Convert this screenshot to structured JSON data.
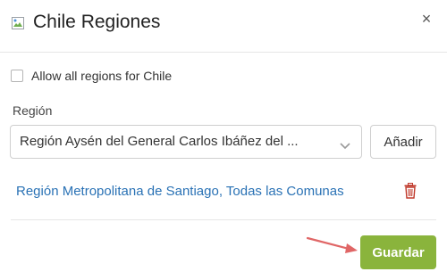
{
  "header": {
    "title": "Chile Regiones",
    "close_symbol": "×",
    "flag_icon": "broken-image-icon"
  },
  "allow_all": {
    "label": "Allow all regions for Chile",
    "checked": false
  },
  "region_field": {
    "label": "Región",
    "selected_value": "Región Aysén del General Carlos Ibáñez del ...",
    "add_label": "Añadir"
  },
  "selected_regions": [
    {
      "name": "Región Metropolitana de Santiago, Todas las Comunas"
    }
  ],
  "footer": {
    "save_label": "Guardar"
  },
  "colors": {
    "link": "#2a72b5",
    "save_button": "#8ab43c",
    "delete_icon": "#c0392b",
    "annotation_arrow": "#e06666"
  }
}
